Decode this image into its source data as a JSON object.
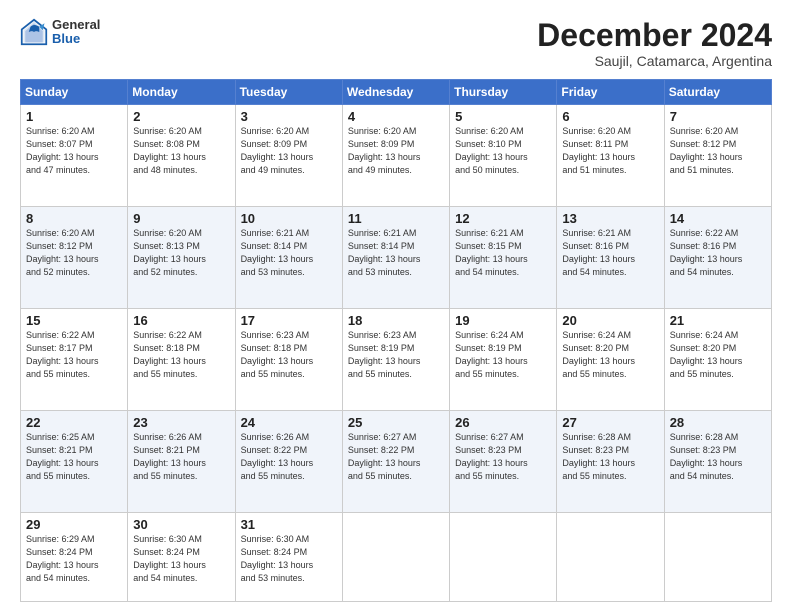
{
  "header": {
    "logo_general": "General",
    "logo_blue": "Blue",
    "month_title": "December 2024",
    "subtitle": "Saujil, Catamarca, Argentina"
  },
  "days_of_week": [
    "Sunday",
    "Monday",
    "Tuesday",
    "Wednesday",
    "Thursday",
    "Friday",
    "Saturday"
  ],
  "weeks": [
    [
      {
        "day": "1",
        "lines": [
          "Sunrise: 6:20 AM",
          "Sunset: 8:07 PM",
          "Daylight: 13 hours",
          "and 47 minutes."
        ]
      },
      {
        "day": "2",
        "lines": [
          "Sunrise: 6:20 AM",
          "Sunset: 8:08 PM",
          "Daylight: 13 hours",
          "and 48 minutes."
        ]
      },
      {
        "day": "3",
        "lines": [
          "Sunrise: 6:20 AM",
          "Sunset: 8:09 PM",
          "Daylight: 13 hours",
          "and 49 minutes."
        ]
      },
      {
        "day": "4",
        "lines": [
          "Sunrise: 6:20 AM",
          "Sunset: 8:09 PM",
          "Daylight: 13 hours",
          "and 49 minutes."
        ]
      },
      {
        "day": "5",
        "lines": [
          "Sunrise: 6:20 AM",
          "Sunset: 8:10 PM",
          "Daylight: 13 hours",
          "and 50 minutes."
        ]
      },
      {
        "day": "6",
        "lines": [
          "Sunrise: 6:20 AM",
          "Sunset: 8:11 PM",
          "Daylight: 13 hours",
          "and 51 minutes."
        ]
      },
      {
        "day": "7",
        "lines": [
          "Sunrise: 6:20 AM",
          "Sunset: 8:12 PM",
          "Daylight: 13 hours",
          "and 51 minutes."
        ]
      }
    ],
    [
      {
        "day": "8",
        "lines": [
          "Sunrise: 6:20 AM",
          "Sunset: 8:12 PM",
          "Daylight: 13 hours",
          "and 52 minutes."
        ]
      },
      {
        "day": "9",
        "lines": [
          "Sunrise: 6:20 AM",
          "Sunset: 8:13 PM",
          "Daylight: 13 hours",
          "and 52 minutes."
        ]
      },
      {
        "day": "10",
        "lines": [
          "Sunrise: 6:21 AM",
          "Sunset: 8:14 PM",
          "Daylight: 13 hours",
          "and 53 minutes."
        ]
      },
      {
        "day": "11",
        "lines": [
          "Sunrise: 6:21 AM",
          "Sunset: 8:14 PM",
          "Daylight: 13 hours",
          "and 53 minutes."
        ]
      },
      {
        "day": "12",
        "lines": [
          "Sunrise: 6:21 AM",
          "Sunset: 8:15 PM",
          "Daylight: 13 hours",
          "and 54 minutes."
        ]
      },
      {
        "day": "13",
        "lines": [
          "Sunrise: 6:21 AM",
          "Sunset: 8:16 PM",
          "Daylight: 13 hours",
          "and 54 minutes."
        ]
      },
      {
        "day": "14",
        "lines": [
          "Sunrise: 6:22 AM",
          "Sunset: 8:16 PM",
          "Daylight: 13 hours",
          "and 54 minutes."
        ]
      }
    ],
    [
      {
        "day": "15",
        "lines": [
          "Sunrise: 6:22 AM",
          "Sunset: 8:17 PM",
          "Daylight: 13 hours",
          "and 55 minutes."
        ]
      },
      {
        "day": "16",
        "lines": [
          "Sunrise: 6:22 AM",
          "Sunset: 8:18 PM",
          "Daylight: 13 hours",
          "and 55 minutes."
        ]
      },
      {
        "day": "17",
        "lines": [
          "Sunrise: 6:23 AM",
          "Sunset: 8:18 PM",
          "Daylight: 13 hours",
          "and 55 minutes."
        ]
      },
      {
        "day": "18",
        "lines": [
          "Sunrise: 6:23 AM",
          "Sunset: 8:19 PM",
          "Daylight: 13 hours",
          "and 55 minutes."
        ]
      },
      {
        "day": "19",
        "lines": [
          "Sunrise: 6:24 AM",
          "Sunset: 8:19 PM",
          "Daylight: 13 hours",
          "and 55 minutes."
        ]
      },
      {
        "day": "20",
        "lines": [
          "Sunrise: 6:24 AM",
          "Sunset: 8:20 PM",
          "Daylight: 13 hours",
          "and 55 minutes."
        ]
      },
      {
        "day": "21",
        "lines": [
          "Sunrise: 6:24 AM",
          "Sunset: 8:20 PM",
          "Daylight: 13 hours",
          "and 55 minutes."
        ]
      }
    ],
    [
      {
        "day": "22",
        "lines": [
          "Sunrise: 6:25 AM",
          "Sunset: 8:21 PM",
          "Daylight: 13 hours",
          "and 55 minutes."
        ]
      },
      {
        "day": "23",
        "lines": [
          "Sunrise: 6:26 AM",
          "Sunset: 8:21 PM",
          "Daylight: 13 hours",
          "and 55 minutes."
        ]
      },
      {
        "day": "24",
        "lines": [
          "Sunrise: 6:26 AM",
          "Sunset: 8:22 PM",
          "Daylight: 13 hours",
          "and 55 minutes."
        ]
      },
      {
        "day": "25",
        "lines": [
          "Sunrise: 6:27 AM",
          "Sunset: 8:22 PM",
          "Daylight: 13 hours",
          "and 55 minutes."
        ]
      },
      {
        "day": "26",
        "lines": [
          "Sunrise: 6:27 AM",
          "Sunset: 8:23 PM",
          "Daylight: 13 hours",
          "and 55 minutes."
        ]
      },
      {
        "day": "27",
        "lines": [
          "Sunrise: 6:28 AM",
          "Sunset: 8:23 PM",
          "Daylight: 13 hours",
          "and 55 minutes."
        ]
      },
      {
        "day": "28",
        "lines": [
          "Sunrise: 6:28 AM",
          "Sunset: 8:23 PM",
          "Daylight: 13 hours",
          "and 54 minutes."
        ]
      }
    ],
    [
      {
        "day": "29",
        "lines": [
          "Sunrise: 6:29 AM",
          "Sunset: 8:24 PM",
          "Daylight: 13 hours",
          "and 54 minutes."
        ]
      },
      {
        "day": "30",
        "lines": [
          "Sunrise: 6:30 AM",
          "Sunset: 8:24 PM",
          "Daylight: 13 hours",
          "and 54 minutes."
        ]
      },
      {
        "day": "31",
        "lines": [
          "Sunrise: 6:30 AM",
          "Sunset: 8:24 PM",
          "Daylight: 13 hours",
          "and 53 minutes."
        ]
      },
      null,
      null,
      null,
      null
    ]
  ]
}
